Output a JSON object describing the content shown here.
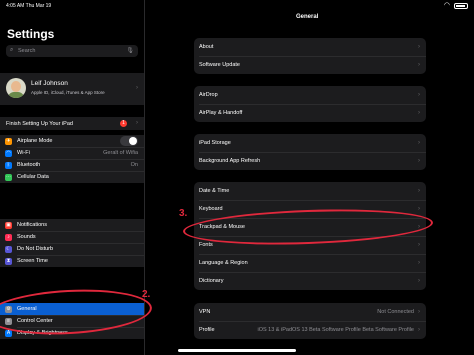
{
  "status_bar": {
    "time": "4:05 AM  Thu Mar 19"
  },
  "sidebar": {
    "title": "Settings",
    "search_placeholder": "Search",
    "profile": {
      "name": "Leif Johnson",
      "subtitle": "Apple ID, iCloud, iTunes & App Store"
    },
    "finish_setup": {
      "label": "Finish Setting Up Your iPad",
      "badge": "1"
    },
    "group1": [
      {
        "label": "Airplane Mode",
        "value": "",
        "icon_color": "#ff9500",
        "icon": "airplane-icon",
        "glyph": "✈"
      },
      {
        "label": "Wi-Fi",
        "value": "Geralt of Wifia",
        "icon_color": "#007aff",
        "icon": "wifi-icon",
        "glyph": "◠"
      },
      {
        "label": "Bluetooth",
        "value": "On",
        "icon_color": "#007aff",
        "icon": "bluetooth-icon",
        "glyph": "ᛒ"
      },
      {
        "label": "Cellular Data",
        "value": "",
        "icon_color": "#34c759",
        "icon": "cellular-icon",
        "glyph": "⋯"
      }
    ],
    "group2": [
      {
        "label": "Notifications",
        "icon_color": "#ff3b30",
        "icon": "notifications-icon",
        "glyph": "▣"
      },
      {
        "label": "Sounds",
        "icon_color": "#ff2d55",
        "icon": "sounds-icon",
        "glyph": "♪"
      },
      {
        "label": "Do Not Disturb",
        "icon_color": "#5856d6",
        "icon": "moon-icon",
        "glyph": "☾"
      },
      {
        "label": "Screen Time",
        "icon_color": "#5856d6",
        "icon": "hourglass-icon",
        "glyph": "⧗"
      }
    ],
    "group3": [
      {
        "label": "General",
        "icon_color": "#8e8e93",
        "icon": "gear-icon",
        "glyph": "⚙"
      },
      {
        "label": "Control Center",
        "icon_color": "#8e8e93",
        "icon": "control-center-icon",
        "glyph": "≡"
      },
      {
        "label": "Display & Brightness",
        "icon_color": "#007aff",
        "icon": "display-icon",
        "glyph": "A"
      }
    ]
  },
  "main": {
    "title": "General",
    "group1": [
      "About",
      "Software Update"
    ],
    "group2": [
      "AirDrop",
      "AirPlay & Handoff"
    ],
    "group3": [
      "iPad Storage",
      "Background App Refresh"
    ],
    "group4": [
      "Date & Time",
      "Keyboard",
      "Trackpad & Mouse",
      "Fonts",
      "Language & Region",
      "Dictionary"
    ],
    "group5": [
      {
        "label": "VPN",
        "value": "Not Connected"
      },
      {
        "label": "Profile",
        "value": "iOS 13 & iPadOS 13 Beta Software Profile Beta Software Profile"
      }
    ]
  },
  "annotations": {
    "label_2": "2.",
    "label_3": "3.",
    "color": "#e0283c"
  }
}
